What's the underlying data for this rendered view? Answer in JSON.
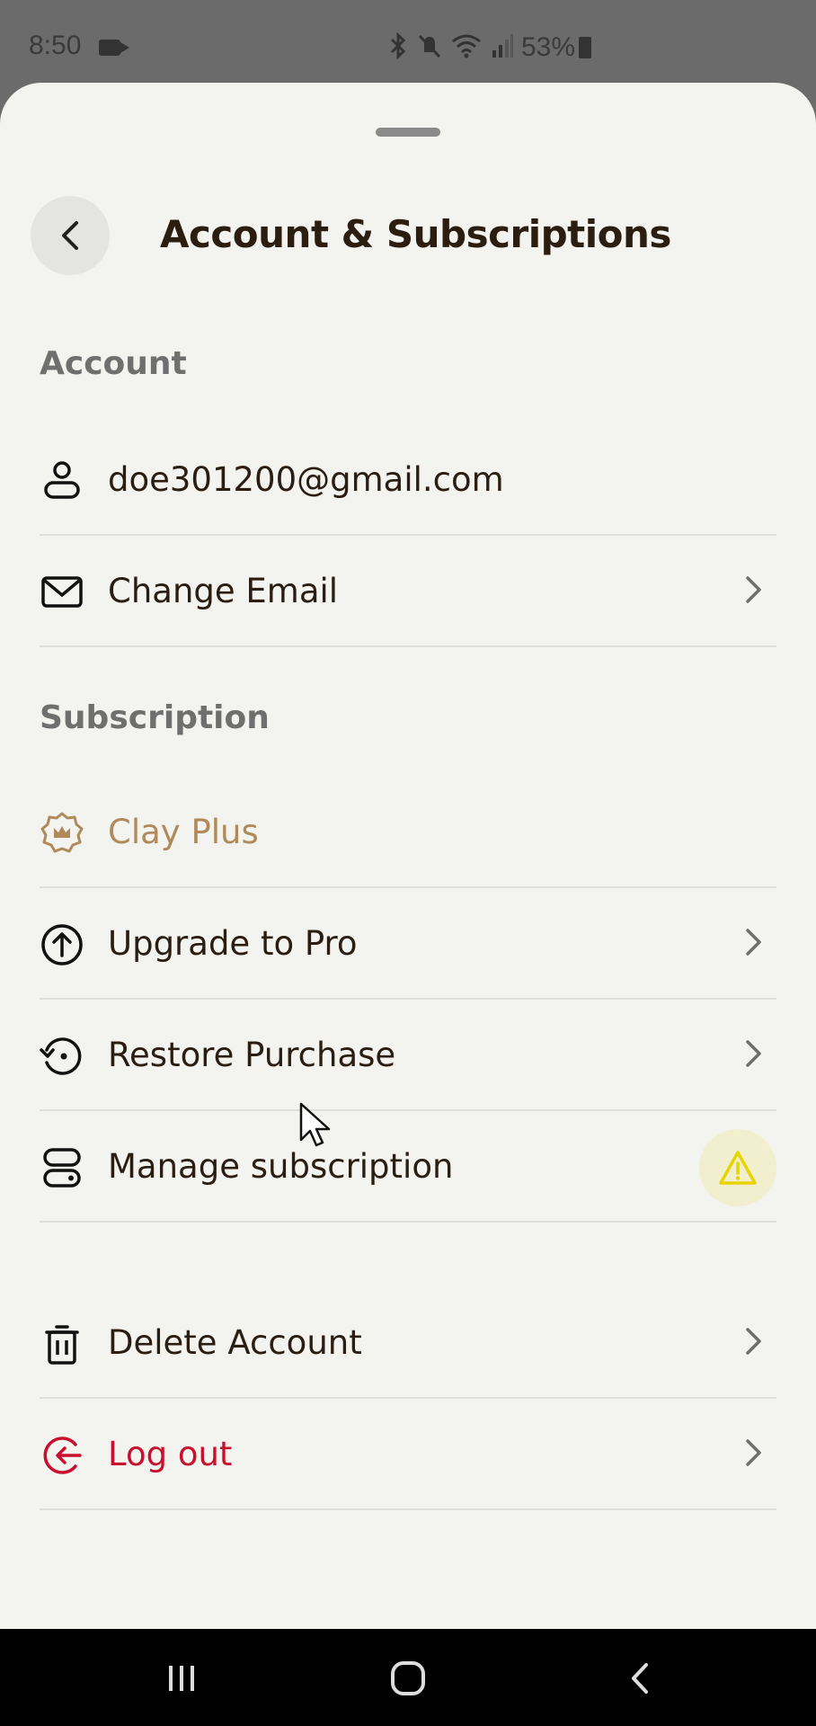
{
  "status_bar": {
    "time": "8:50",
    "battery": "53%",
    "icons": [
      "bluetooth-icon",
      "mute-icon",
      "wifi-icon",
      "signal-icon"
    ]
  },
  "header": {
    "title": "Account & Subscriptions",
    "back_icon": "chevron-left-icon"
  },
  "account": {
    "section_title": "Account",
    "items": [
      {
        "label": "doe301200@gmail.com",
        "icon": "user-icon",
        "chevron": false
      },
      {
        "label": "Change Email",
        "icon": "mail-icon",
        "chevron": true
      }
    ]
  },
  "subscription": {
    "section_title": "Subscription",
    "items": [
      {
        "label": "Clay Plus",
        "icon": "crown-badge-icon",
        "chevron": false
      },
      {
        "label": "Upgrade to Pro",
        "icon": "arrow-up-circle-icon",
        "chevron": true
      },
      {
        "label": "Restore Purchase",
        "icon": "history-icon",
        "chevron": true
      },
      {
        "label": "Manage subscription",
        "icon": "toggle-stack-icon",
        "chevron": false,
        "warning": true
      }
    ]
  },
  "danger": {
    "items": [
      {
        "label": "Delete Account",
        "icon": "trash-icon",
        "chevron": true
      },
      {
        "label": "Log out",
        "icon": "logout-icon",
        "chevron": true
      }
    ]
  },
  "colors": {
    "sheet_bg": "#f3f3ef",
    "text": "#2a1d12",
    "section": "#6f6f6f",
    "plus_gold": "#b08a5a",
    "logout_red": "#c8102e",
    "warning_yellow": "#e8d400"
  },
  "nav_bar": [
    "recent-apps-icon",
    "home-icon",
    "back-icon"
  ]
}
